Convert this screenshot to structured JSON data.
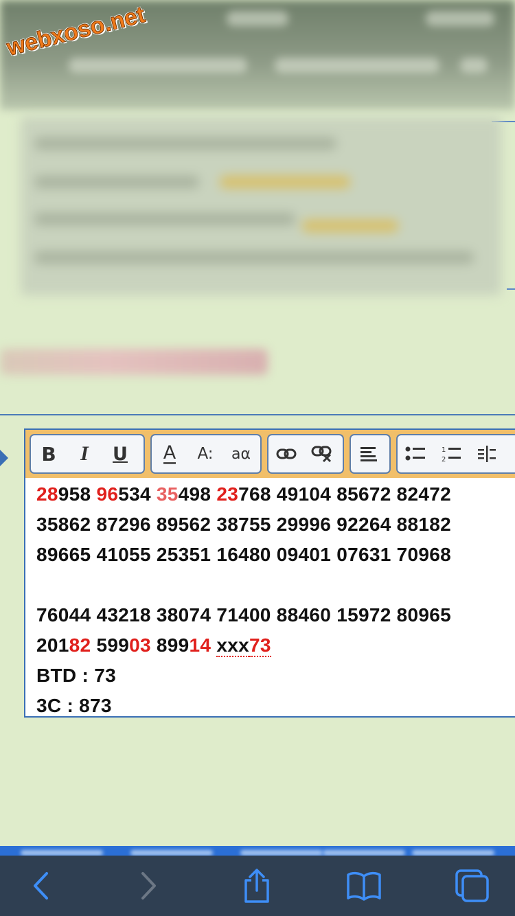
{
  "watermark": {
    "text": "webxoso.net"
  },
  "editor": {
    "toolbar": {
      "bold_label": "B",
      "italic_label": "I",
      "underline_label": "U",
      "font_color_label": "A",
      "font_size_label": "A:",
      "font_case_label": "aα"
    },
    "rows": [
      [
        {
          "text": "28",
          "color": "red"
        },
        {
          "text": "958 "
        },
        {
          "text": "96",
          "color": "red"
        },
        {
          "text": "534 "
        },
        {
          "text": "35",
          "color": "pink"
        },
        {
          "text": "498 "
        },
        {
          "text": "23",
          "color": "red"
        },
        {
          "text": "768 49104 85672 82472"
        }
      ],
      [
        {
          "text": "35862 87296 89562 38755 29996 92264 88182"
        }
      ],
      [
        {
          "text": "89665 41055 25351 16480 09401 07631 70968"
        }
      ],
      [
        {
          "text": ""
        }
      ],
      [
        {
          "text": "76044 43218 38074 71400 88460 15972 80965"
        }
      ],
      [
        {
          "text": "201"
        },
        {
          "text": "82",
          "color": "red"
        },
        {
          "text": " 599"
        },
        {
          "text": "03",
          "color": "red"
        },
        {
          "text": " 899"
        },
        {
          "text": "14",
          "color": "red"
        },
        {
          "text": " "
        },
        {
          "text": "xxx",
          "spell": true
        },
        {
          "text": "73",
          "color": "red",
          "spell": true
        }
      ],
      [
        {
          "text": "BTD : 73"
        }
      ],
      [
        {
          "text": "3C : 873"
        }
      ]
    ]
  },
  "colors": {
    "page_background": "#dfeccb",
    "toolbar_background": "#f1bf6a",
    "accent_blue": "#3a6fb5",
    "highlight_red": "#e0201c",
    "safari_bar": "#2f3f52",
    "safari_icon": "#3e8ef7"
  },
  "safari_bar": {
    "icons": [
      "back-icon",
      "forward-icon",
      "share-icon",
      "bookmarks-icon",
      "tabs-icon"
    ]
  }
}
